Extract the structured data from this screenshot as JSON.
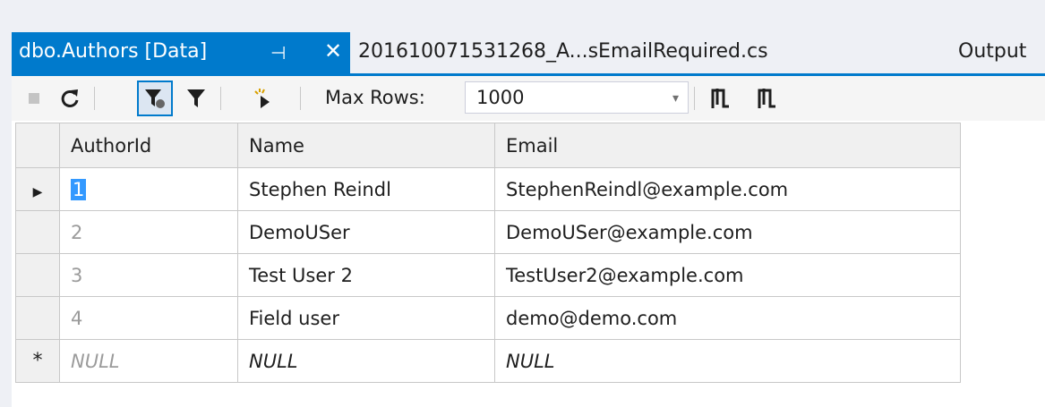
{
  "tabs": {
    "active": {
      "title": "dbo.Authors [Data]"
    },
    "inactive": {
      "title": "201610071531268_A...sEmailRequired.cs"
    },
    "output": {
      "title": "Output"
    }
  },
  "icons": {
    "pin": "⊣",
    "close": "✕",
    "dropdown": "▾",
    "row_pointer": "▶",
    "new_row": "*"
  },
  "toolbar": {
    "max_rows_label": "Max Rows:",
    "max_rows_value": "1000"
  },
  "grid": {
    "columns": [
      "AuthorId",
      "Name",
      "Email"
    ],
    "rows": [
      {
        "id": "1",
        "name": "Stephen Reindl",
        "email": "StephenReindl@example.com"
      },
      {
        "id": "2",
        "name": "DemoUSer",
        "email": "DemoUSer@example.com"
      },
      {
        "id": "3",
        "name": "Test User 2",
        "email": "TestUser2@example.com"
      },
      {
        "id": "4",
        "name": "Field user",
        "email": "demo@demo.com"
      }
    ],
    "new_row": {
      "id": "NULL",
      "name": "NULL",
      "email": "NULL"
    }
  },
  "colors": {
    "accent": "#007acc",
    "selection": "#3399ff"
  }
}
